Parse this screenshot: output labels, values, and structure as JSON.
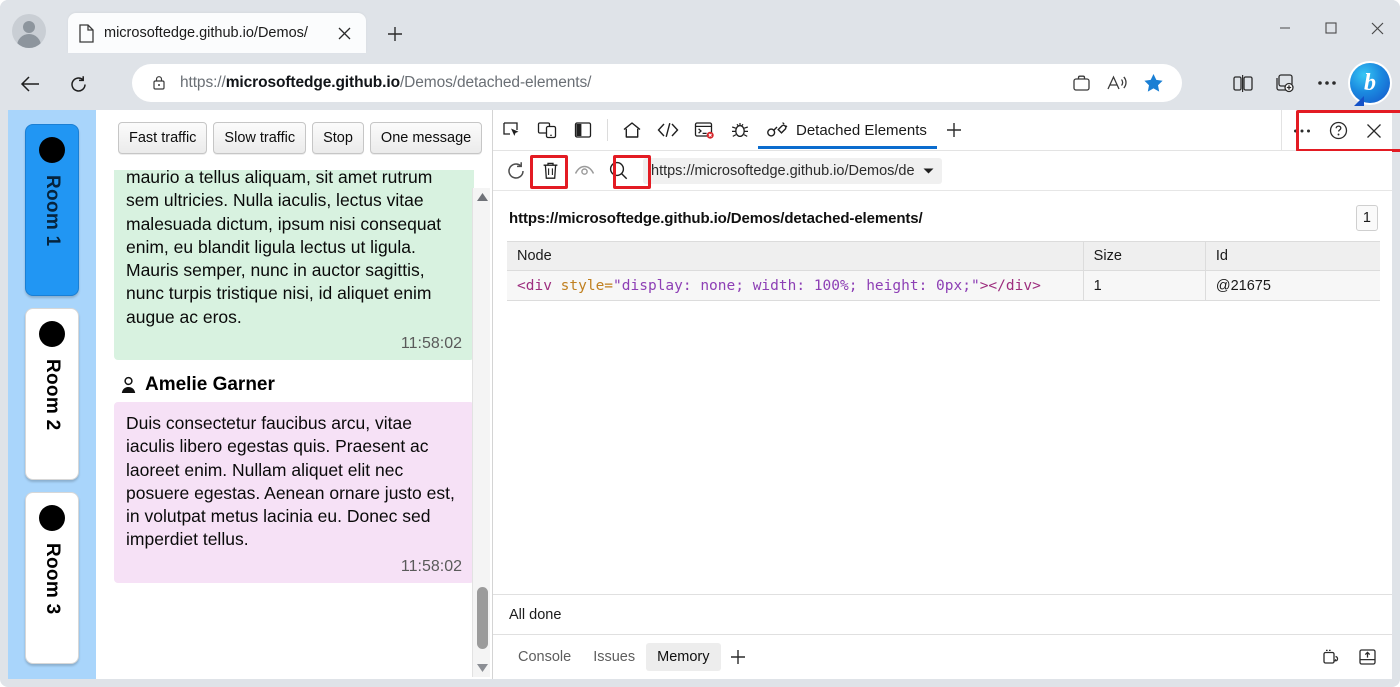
{
  "browser": {
    "tab": {
      "title": "microsoftedge.github.io/Demos/",
      "favicon_icon": "page-icon",
      "close_icon": "close-icon"
    },
    "new_tab_icon": "plus-icon",
    "window_controls": {
      "minimize": "minimize-icon",
      "maximize": "maximize-icon",
      "close": "close-icon"
    },
    "nav": {
      "back_icon": "back-arrow-icon",
      "refresh_icon": "refresh-icon"
    },
    "omnibox": {
      "lock_icon": "lock-icon",
      "url_scheme": "https://",
      "url_host": "microsoftedge.github.io",
      "url_path": "/Demos/detached-elements/",
      "icons": [
        "wallet-icon",
        "read-aloud-icon",
        "favorite-star-icon"
      ]
    },
    "toolbar_icons": [
      "split-screen-icon",
      "collections-icon",
      "more-settings-icon"
    ],
    "copilot": {
      "label": "b",
      "name": "bing-copilot-button"
    }
  },
  "page": {
    "rooms": [
      {
        "label": "Room 1",
        "active": true
      },
      {
        "label": "Room 2",
        "active": false
      },
      {
        "label": "Room 3",
        "active": false
      }
    ],
    "buttons": [
      "Fast traffic",
      "Slow traffic",
      "Stop",
      "One message"
    ],
    "messages": [
      {
        "author": null,
        "color": "green",
        "text": "maurio a tellus aliquam, sit amet rutrum sem ultricies. Nulla iaculis, lectus vitae malesuada dictum, ipsum nisi consequat enim, eu blandit ligula lectus ut ligula. Mauris semper, nunc in auctor sagittis, nunc turpis tristique nisi, id aliquet enim augue ac eros.",
        "time": "11:58:02"
      },
      {
        "author": "Amelie Garner",
        "color": "pink",
        "text": "Duis consectetur faucibus arcu, vitae iaculis libero egestas quis. Praesent ac laoreet enim. Nullam aliquet elit nec posuere egestas. Aenean ornare justo est, in volutpat metus lacinia eu. Donec sed imperdiet tellus.",
        "time": "11:58:02"
      }
    ]
  },
  "devtools": {
    "left_icons": [
      "inspect-element-icon",
      "device-emulation-icon",
      "dock-panel-icon"
    ],
    "panel_icons": [
      "home-icon",
      "elements-icon",
      "console-icon",
      "debugger-icon"
    ],
    "selected_tab": {
      "label": "Detached Elements",
      "icon": "detached-plug-icon"
    },
    "add_tab_icon": "plus-icon",
    "right_icons": [
      "more-tools-icon",
      "help-icon",
      "close-devtools-icon"
    ],
    "toolbar2": {
      "refresh_icon": "refresh-icon",
      "delete_icon": "trash-icon",
      "visibility_icon": "eye-icon",
      "search_icon": "search-icon",
      "url_value": "https://microsoftedge.github.io/Demos/de",
      "dropdown_icon": "chevron-down-icon"
    },
    "content": {
      "url_heading": "https://microsoftedge.github.io/Demos/detached-elements/",
      "count_badge": "1",
      "columns": [
        "Node",
        "Size",
        "Id"
      ],
      "rows": [
        {
          "node": {
            "open_tag": "<div",
            "attr_name": " style=",
            "attr_value": "\"display: none; width: 100%; height: 0px;\"",
            "tag_close": ">",
            "close_tag": "</div>"
          },
          "size": "1",
          "id": "@21675"
        }
      ]
    },
    "status_text": "All done",
    "drawer_tabs": [
      {
        "label": "Console",
        "active": false
      },
      {
        "label": "Issues",
        "active": false
      },
      {
        "label": "Memory",
        "active": true
      }
    ],
    "drawer_add_icon": "plus-icon",
    "drawer_right_icons": [
      "settings-drawer-icon",
      "dock-drawer-icon"
    ]
  },
  "colors": {
    "accent_blue": "#0a6cce",
    "highlight_red": "#e31b23",
    "room_active": "#2196f3",
    "rail_bg": "#a9d5fb",
    "bubble_green": "#d8f2e0",
    "bubble_pink": "#f6e1f6"
  }
}
